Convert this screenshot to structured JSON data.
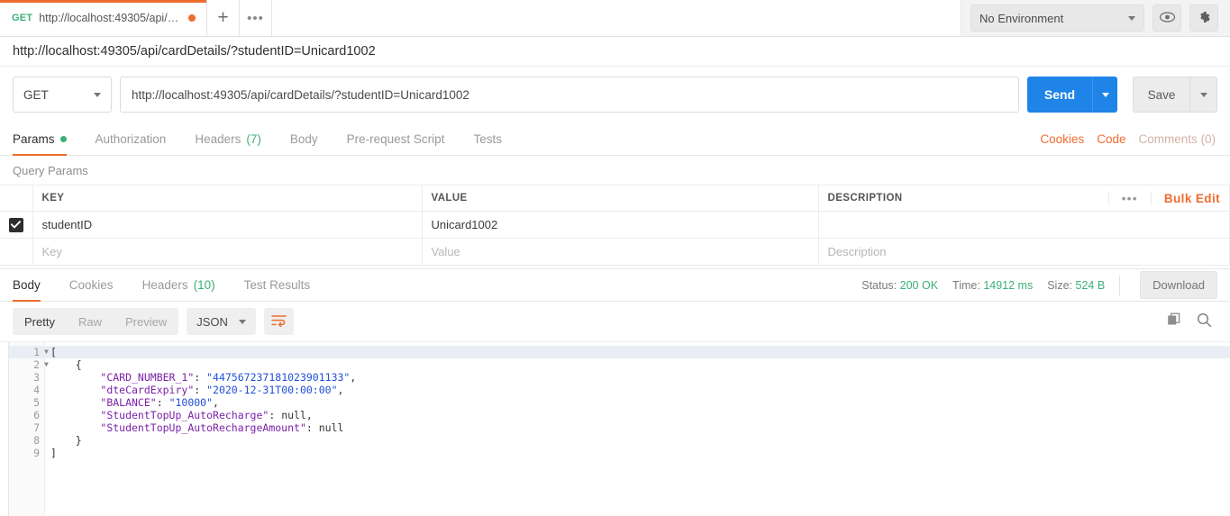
{
  "tab": {
    "method": "GET",
    "url_truncated": "http://localhost:49305/api/card...",
    "new_tab_icon": "plus-icon",
    "overflow_icon": "ellipsis-icon"
  },
  "topbar": {
    "environment": "No Environment",
    "eye_icon": "eye-icon",
    "settings_icon": "gear-icon"
  },
  "request": {
    "title": "http://localhost:49305/api/cardDetails/?studentID=Unicard1002",
    "method": "GET",
    "url": "http://localhost:49305/api/cardDetails/?studentID=Unicard1002",
    "send_label": "Send",
    "save_label": "Save"
  },
  "request_tabs": [
    {
      "label": "Params",
      "badge": "",
      "dot": true,
      "active": true
    },
    {
      "label": "Authorization",
      "badge": "",
      "dot": false,
      "active": false
    },
    {
      "label": "Headers",
      "badge": "(7)",
      "dot": false,
      "active": false
    },
    {
      "label": "Body",
      "badge": "",
      "dot": false,
      "active": false
    },
    {
      "label": "Pre-request Script",
      "badge": "",
      "dot": false,
      "active": false
    },
    {
      "label": "Tests",
      "badge": "",
      "dot": false,
      "active": false
    }
  ],
  "request_links": {
    "cookies": "Cookies",
    "code": "Code",
    "comments": "Comments (0)"
  },
  "params": {
    "section_label": "Query Params",
    "headers": {
      "key": "KEY",
      "value": "VALUE",
      "description": "DESCRIPTION"
    },
    "bulk_edit": "Bulk Edit",
    "rows": [
      {
        "checked": true,
        "key": "studentID",
        "value": "Unicard1002",
        "description": ""
      }
    ],
    "placeholder_row": {
      "key": "Key",
      "value": "Value",
      "description": "Description"
    }
  },
  "response_tabs": [
    {
      "label": "Body",
      "badge": "",
      "active": true
    },
    {
      "label": "Cookies",
      "badge": "",
      "active": false
    },
    {
      "label": "Headers",
      "badge": "(10)",
      "active": false
    },
    {
      "label": "Test Results",
      "badge": "",
      "active": false
    }
  ],
  "response_meta": {
    "status_label": "Status:",
    "status_value": "200 OK",
    "time_label": "Time:",
    "time_value": "14912 ms",
    "size_label": "Size:",
    "size_value": "524 B",
    "download_label": "Download"
  },
  "response_toolbar": {
    "view_modes": [
      {
        "label": "Pretty",
        "active": true
      },
      {
        "label": "Raw",
        "active": false
      },
      {
        "label": "Preview",
        "active": false
      }
    ],
    "format": "JSON",
    "wrap_icon": "word-wrap-icon",
    "copy_icon": "copy-icon",
    "search_icon": "search-icon"
  },
  "response_body": {
    "language": "json",
    "lines": [
      {
        "num": "1",
        "foldable": true,
        "indent": 0,
        "tokens": [
          {
            "t": "[",
            "c": "p"
          }
        ]
      },
      {
        "num": "2",
        "foldable": true,
        "indent": 1,
        "tokens": [
          {
            "t": "{",
            "c": "p"
          }
        ]
      },
      {
        "num": "3",
        "foldable": false,
        "indent": 2,
        "tokens": [
          {
            "t": "\"CARD_NUMBER_1\"",
            "c": "k"
          },
          {
            "t": ": ",
            "c": "p"
          },
          {
            "t": "\"447567237181023901133\"",
            "c": "s"
          },
          {
            "t": ",",
            "c": "p"
          }
        ]
      },
      {
        "num": "4",
        "foldable": false,
        "indent": 2,
        "tokens": [
          {
            "t": "\"dteCardExpiry\"",
            "c": "k"
          },
          {
            "t": ": ",
            "c": "p"
          },
          {
            "t": "\"2020-12-31T00:00:00\"",
            "c": "s"
          },
          {
            "t": ",",
            "c": "p"
          }
        ]
      },
      {
        "num": "5",
        "foldable": false,
        "indent": 2,
        "tokens": [
          {
            "t": "\"BALANCE\"",
            "c": "k"
          },
          {
            "t": ": ",
            "c": "p"
          },
          {
            "t": "\"10000\"",
            "c": "s"
          },
          {
            "t": ",",
            "c": "p"
          }
        ]
      },
      {
        "num": "6",
        "foldable": false,
        "indent": 2,
        "tokens": [
          {
            "t": "\"StudentTopUp_AutoRecharge\"",
            "c": "k"
          },
          {
            "t": ": ",
            "c": "p"
          },
          {
            "t": "null",
            "c": "n"
          },
          {
            "t": ",",
            "c": "p"
          }
        ]
      },
      {
        "num": "7",
        "foldable": false,
        "indent": 2,
        "tokens": [
          {
            "t": "\"StudentTopUp_AutoRechargeAmount\"",
            "c": "k"
          },
          {
            "t": ": ",
            "c": "p"
          },
          {
            "t": "null",
            "c": "n"
          }
        ]
      },
      {
        "num": "8",
        "foldable": false,
        "indent": 1,
        "tokens": [
          {
            "t": "}",
            "c": "p"
          }
        ]
      },
      {
        "num": "9",
        "foldable": false,
        "indent": 0,
        "tokens": [
          {
            "t": "]",
            "c": "p"
          }
        ]
      }
    ]
  },
  "colors": {
    "accent_orange": "#ef6c2f",
    "send_blue": "#1e84e8",
    "status_green": "#3bb077",
    "key_purple": "#7b21a8",
    "string_blue": "#1f4fd8"
  }
}
